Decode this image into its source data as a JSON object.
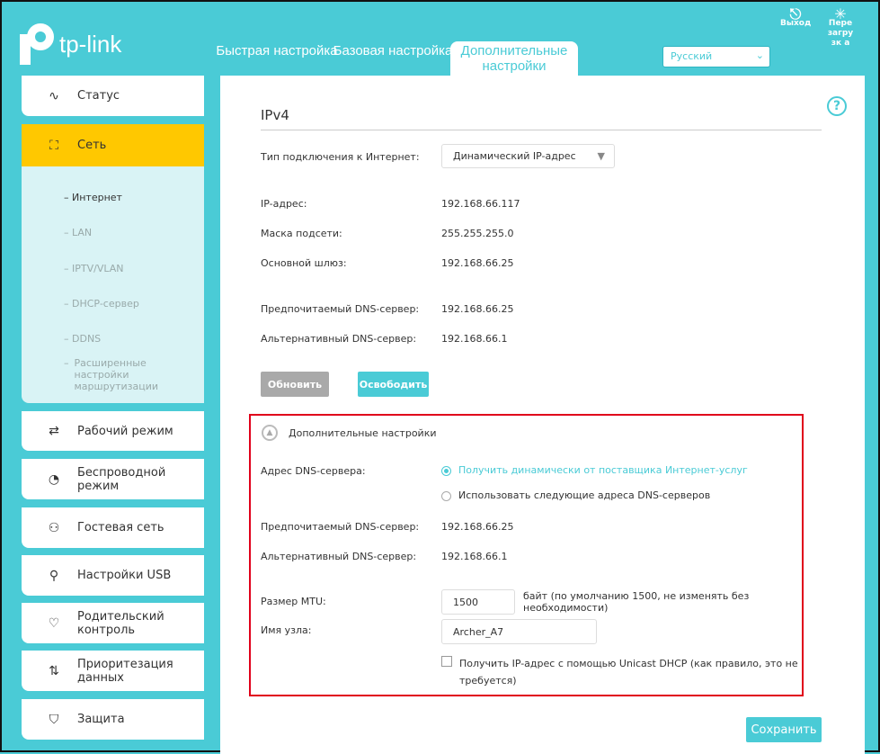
{
  "header": {
    "logo": "tp-link",
    "tabs": [
      "Быстрая настройка",
      "Базовая настройка",
      "Дополнительные настройки"
    ],
    "language": "Русский",
    "logout": "Выход",
    "reboot": "Пере загрузк а"
  },
  "sidebar": {
    "items": [
      "Статус",
      "Сеть",
      "Рабочий режим",
      "Беспроводной режим",
      "Гостевая сеть",
      "Настройки USB",
      "Родительский контроль",
      "Приоритезация данных",
      "Защита"
    ],
    "sub": [
      "Интернет",
      "LAN",
      "IPTV/VLAN",
      "DHCP-сервер",
      "DDNS",
      "Расширенные настройки маршрутизации"
    ]
  },
  "main": {
    "title": "IPv4",
    "conn_label": "Тип подключения к Интернет:",
    "conn_value": "Динамический IP-адрес",
    "ip_label": "IP-адрес:",
    "ip": "192.168.66.117",
    "mask_label": "Маска подсети:",
    "mask": "255.255.255.0",
    "gw_label": "Основной шлюз:",
    "gw": "192.168.66.25",
    "dns1_label": "Предпочитаемый DNS-сервер:",
    "dns1": "192.168.66.25",
    "dns2_label": "Альтернативный DNS-сервер:",
    "dns2": "192.168.66.1",
    "renew": "Обновить",
    "release": "Освободить",
    "adv": {
      "title": "Дополнительные настройки",
      "dns_label": "Адрес DNS-сервера:",
      "opt1": "Получить динамически от поставщика Интернет-услуг",
      "opt2": "Использовать следующие адреса DNS-серверов",
      "dns1_label": "Предпочитаемый DNS-сервер:",
      "dns1": "192.168.66.25",
      "dns2_label": "Альтернативный DNS-сервер:",
      "dns2": "192.168.66.1",
      "mtu_label": "Размер MTU:",
      "mtu": "1500",
      "mtu_hint": "байт (по умолчанию 1500, не изменять без необходимости)",
      "host_label": "Имя узла:",
      "host": "Archer_A7",
      "unicast": "Получить IP-адрес с помощью Unicast DHCP (как правило, это не требуется)"
    },
    "save": "Сохранить"
  },
  "colors": {
    "accent": "#4acbd6",
    "active": "#ffc800",
    "highlight": "#e0001b"
  }
}
